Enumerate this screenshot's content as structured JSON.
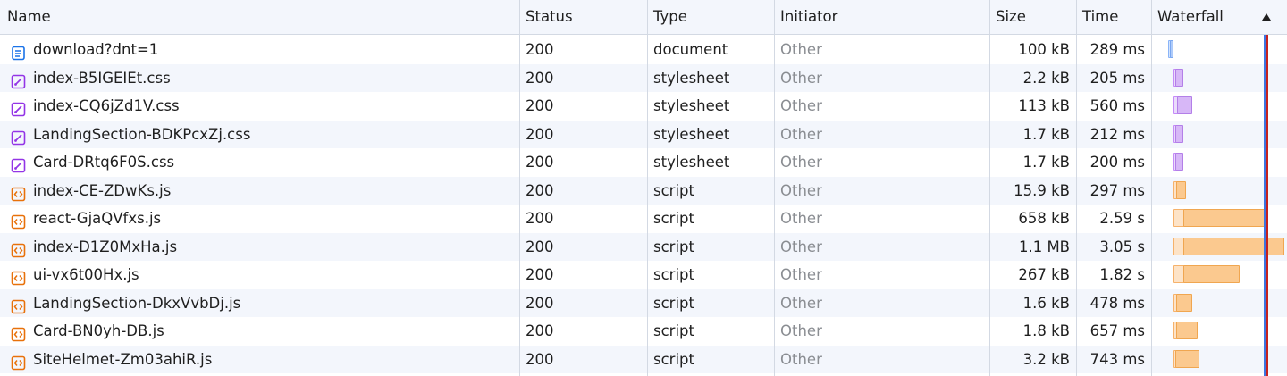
{
  "columns": {
    "name": "Name",
    "status": "Status",
    "type": "Type",
    "initiator": "Initiator",
    "size": "Size",
    "time": "Time",
    "waterfall": "Waterfall"
  },
  "sort": {
    "column": "waterfall",
    "direction": "ascending"
  },
  "colors": {
    "document": "#1a73e8",
    "stylesheet": "#9334e6",
    "script": "#e8710a",
    "header_bg": "#f3f6fc",
    "grid": "#d3d9e3",
    "muted_text": "#8a8d92",
    "marker_blue": "#3c73e0",
    "marker_red": "#c5221f"
  },
  "requests": [
    {
      "name": "download?dnt=1",
      "status": "200",
      "type": "document",
      "icon": "document-icon",
      "initiator": "Other",
      "size": "100 kB",
      "time": "289 ms",
      "waterfall": {
        "wait": 0.0,
        "download": 0.02
      }
    },
    {
      "name": "index-B5IGEIEt.css",
      "status": "200",
      "type": "stylesheet",
      "icon": "stylesheet-icon",
      "initiator": "Other",
      "size": "2.2 kB",
      "time": "205 ms",
      "waterfall": {
        "wait": 0.02,
        "download": 0.08
      }
    },
    {
      "name": "index-CQ6jZd1V.css",
      "status": "200",
      "type": "stylesheet",
      "icon": "stylesheet-icon",
      "initiator": "Other",
      "size": "113 kB",
      "time": "560 ms",
      "waterfall": {
        "wait": 0.04,
        "download": 0.14
      }
    },
    {
      "name": "LandingSection-BDKPcxZj.css",
      "status": "200",
      "type": "stylesheet",
      "icon": "stylesheet-icon",
      "initiator": "Other",
      "size": "1.7 kB",
      "time": "212 ms",
      "waterfall": {
        "wait": 0.02,
        "download": 0.08
      }
    },
    {
      "name": "Card-DRtq6F0S.css",
      "status": "200",
      "type": "stylesheet",
      "icon": "stylesheet-icon",
      "initiator": "Other",
      "size": "1.7 kB",
      "time": "200 ms",
      "waterfall": {
        "wait": 0.02,
        "download": 0.08
      }
    },
    {
      "name": "index-CE-ZDwKs.js",
      "status": "200",
      "type": "script",
      "icon": "script-icon",
      "initiator": "Other",
      "size": "15.9 kB",
      "time": "297 ms",
      "waterfall": {
        "wait": 0.03,
        "download": 0.09
      }
    },
    {
      "name": "react-GjaQVfxs.js",
      "status": "200",
      "type": "script",
      "icon": "script-icon",
      "initiator": "Other",
      "size": "658 kB",
      "time": "2.59 s",
      "waterfall": {
        "wait": 0.1,
        "download": 0.8
      }
    },
    {
      "name": "index-D1Z0MxHa.js",
      "status": "200",
      "type": "script",
      "icon": "script-icon",
      "initiator": "Other",
      "size": "1.1 MB",
      "time": "3.05 s",
      "waterfall": {
        "wait": 0.1,
        "download": 0.96
      }
    },
    {
      "name": "ui-vx6t00Hx.js",
      "status": "200",
      "type": "script",
      "icon": "script-icon",
      "initiator": "Other",
      "size": "267 kB",
      "time": "1.82 s",
      "waterfall": {
        "wait": 0.1,
        "download": 0.53
      }
    },
    {
      "name": "LandingSection-DkxVvbDj.js",
      "status": "200",
      "type": "script",
      "icon": "script-icon",
      "initiator": "Other",
      "size": "1.6 kB",
      "time": "478 ms",
      "waterfall": {
        "wait": 0.03,
        "download": 0.15
      }
    },
    {
      "name": "Card-BN0yh-DB.js",
      "status": "200",
      "type": "script",
      "icon": "script-icon",
      "initiator": "Other",
      "size": "1.8 kB",
      "time": "657 ms",
      "waterfall": {
        "wait": 0.03,
        "download": 0.2
      }
    },
    {
      "name": "SiteHelmet-Zm03ahiR.js",
      "status": "200",
      "type": "script",
      "icon": "script-icon",
      "initiator": "Other",
      "size": "3.2 kB",
      "time": "743 ms",
      "waterfall": {
        "wait": 0.02,
        "download": 0.23
      }
    }
  ]
}
